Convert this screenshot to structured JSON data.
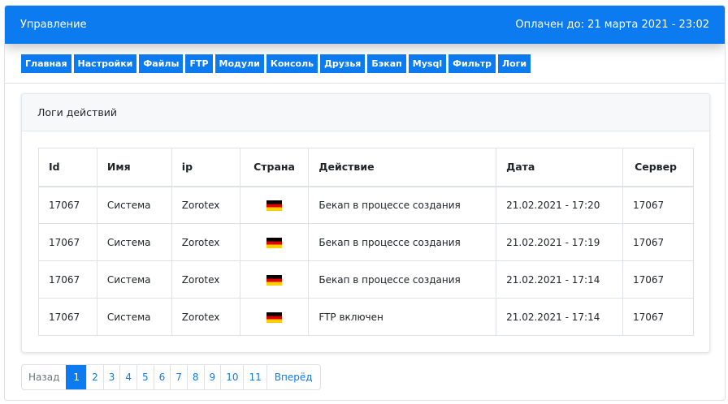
{
  "header": {
    "title": "Управление",
    "paid_until": "Оплачен до: 21 марта 2021 - 23:02"
  },
  "tabs": [
    "Главная",
    "Настройки",
    "Файлы",
    "FTP",
    "Модули",
    "Консоль",
    "Друзья",
    "Бэкап",
    "Mysql",
    "Фильтр",
    "Логи"
  ],
  "card": {
    "title": "Логи действий",
    "columns": [
      "Id",
      "Имя",
      "ip",
      "Страна",
      "Действие",
      "Дата",
      "Сервер"
    ],
    "rows": [
      {
        "id": "17067",
        "name": "Система",
        "ip": "Zorotex",
        "country_flag": "germany-flag-icon",
        "action": "Бекап в процессе создания",
        "date": "21.02.2021 - 17:20",
        "server": "17067"
      },
      {
        "id": "17067",
        "name": "Система",
        "ip": "Zorotex",
        "country_flag": "germany-flag-icon",
        "action": "Бекап в процессе создания",
        "date": "21.02.2021 - 17:19",
        "server": "17067"
      },
      {
        "id": "17067",
        "name": "Система",
        "ip": "Zorotex",
        "country_flag": "germany-flag-icon",
        "action": "Бекап в процессе создания",
        "date": "21.02.2021 - 17:14",
        "server": "17067"
      },
      {
        "id": "17067",
        "name": "Система",
        "ip": "Zorotex",
        "country_flag": "germany-flag-icon",
        "action": "FTP включен",
        "date": "21.02.2021 - 17:14",
        "server": "17067"
      }
    ]
  },
  "pagination": {
    "prev_label": "Назад",
    "pages": [
      "1",
      "2",
      "3",
      "4",
      "5",
      "6",
      "7",
      "8",
      "9",
      "10",
      "11"
    ],
    "active_page": "1",
    "next_label": "Вперёд"
  },
  "colors": {
    "accent": "#0d7bf0",
    "border": "#dee2e6"
  }
}
